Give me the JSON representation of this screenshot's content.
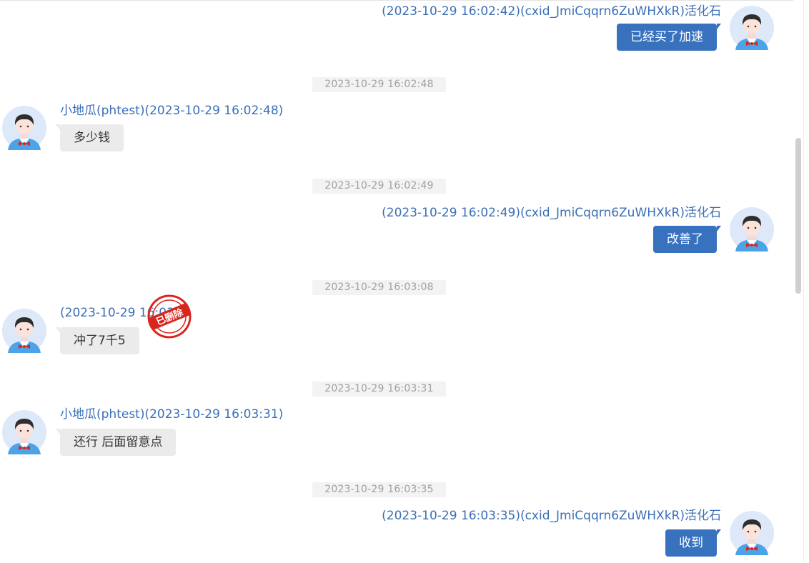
{
  "messages": [
    {
      "side": "right",
      "sender": "(2023-10-29 16:02:42)(cxid_JmiCqqrn6ZuWHXkR)活化石",
      "text": "已经买了加速"
    },
    {
      "timestamp": "2023-10-29 16:02:48",
      "side": "left",
      "sender": "小地瓜(phtest)(2023-10-29 16:02:48)",
      "text": "多少钱"
    },
    {
      "timestamp": "2023-10-29 16:02:49",
      "side": "right",
      "sender": "(2023-10-29 16:02:49)(cxid_JmiCqqrn6ZuWHXkR)活化石",
      "text": "改善了"
    },
    {
      "timestamp": "2023-10-29 16:03:08",
      "side": "left",
      "sender": "(2023-10-29 16:03",
      "text": "冲了7千5",
      "stamp": "已删除"
    },
    {
      "timestamp": "2023-10-29 16:03:31",
      "side": "left",
      "sender": "小地瓜(phtest)(2023-10-29 16:03:31)",
      "text": "还行 后面留意点"
    },
    {
      "timestamp": "2023-10-29 16:03:35",
      "side": "right",
      "sender": "(2023-10-29 16:03:35)(cxid_JmiCqqrn6ZuWHXkR)活化石",
      "text": "收到"
    }
  ],
  "colors": {
    "sender_text": "#3b6fb6",
    "right_bubble": "#3872bf",
    "left_bubble": "#ebebeb",
    "timestamp_bg": "#f3f3f3",
    "stamp_red": "#d9261c"
  },
  "icons": {
    "avatar": "cartoon-user-avatar-icon",
    "stamp": "deleted-stamp-icon"
  }
}
